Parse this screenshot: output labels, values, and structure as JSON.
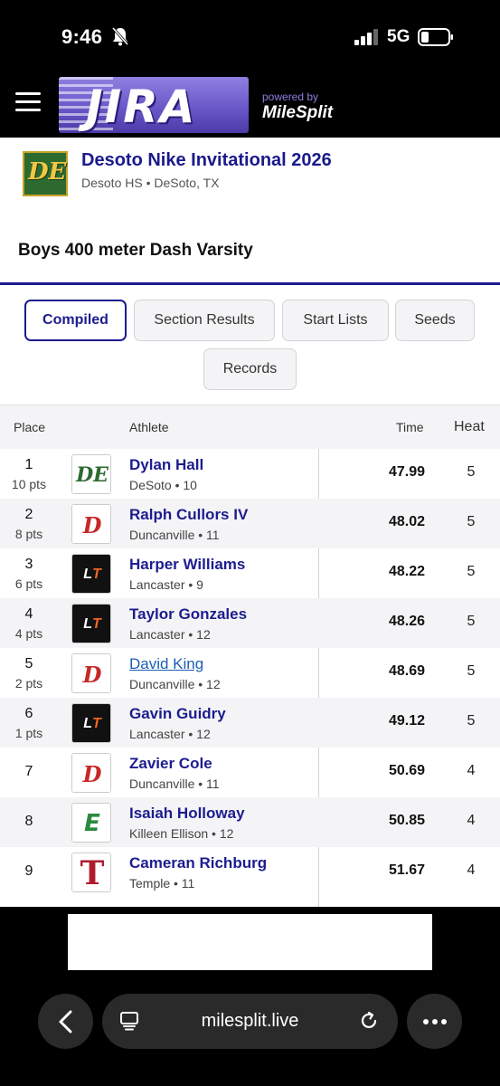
{
  "status_bar": {
    "time": "9:46",
    "network": "5G"
  },
  "header": {
    "logo_text": "JIRA",
    "powered_by": "powered by",
    "partner": "MileSplit"
  },
  "meet": {
    "logo_text": "DE",
    "title": "Desoto Nike Invitational 2026",
    "location": "Desoto HS • DeSoto, TX"
  },
  "event": {
    "title": "Boys 400 meter Dash Varsity"
  },
  "tabs": [
    {
      "label": "Compiled",
      "active": true
    },
    {
      "label": "Section Results",
      "active": false
    },
    {
      "label": "Start Lists",
      "active": false
    },
    {
      "label": "Seeds",
      "active": false
    },
    {
      "label": "Records",
      "active": false
    }
  ],
  "table": {
    "headers": {
      "place": "Place",
      "athlete": "Athlete",
      "time": "Time",
      "heat": "Heat"
    },
    "rows": [
      {
        "place": "1",
        "points": "10 pts",
        "logo": "DE",
        "athlete": "Dylan Hall",
        "team": "DeSoto • 10",
        "time": "47.99",
        "heat": "5"
      },
      {
        "place": "2",
        "points": "8 pts",
        "logo": "D",
        "athlete": "Ralph Cullors IV",
        "team": "Duncanville • 11",
        "time": "48.02",
        "heat": "5"
      },
      {
        "place": "3",
        "points": "6 pts",
        "logo": "LT",
        "athlete": "Harper Williams",
        "team": "Lancaster • 9",
        "time": "48.22",
        "heat": "5"
      },
      {
        "place": "4",
        "points": "4 pts",
        "logo": "LT",
        "athlete": "Taylor Gonzales",
        "team": "Lancaster • 12",
        "time": "48.26",
        "heat": "5"
      },
      {
        "place": "5",
        "points": "2 pts",
        "logo": "D",
        "athlete": "David King",
        "team": "Duncanville • 12",
        "time": "48.69",
        "heat": "5"
      },
      {
        "place": "6",
        "points": "1 pts",
        "logo": "LT",
        "athlete": "Gavin Guidry",
        "team": "Lancaster • 12",
        "time": "49.12",
        "heat": "5"
      },
      {
        "place": "7",
        "points": "",
        "logo": "D",
        "athlete": "Zavier Cole",
        "team": "Duncanville • 11",
        "time": "50.69",
        "heat": "4"
      },
      {
        "place": "8",
        "points": "",
        "logo": "E",
        "athlete": "Isaiah Holloway",
        "team": "Killeen Ellison • 12",
        "time": "50.85",
        "heat": "4"
      },
      {
        "place": "9",
        "points": "",
        "logo": "T",
        "athlete": "Cameran Richburg",
        "team": "Temple • 11",
        "time": "51.67",
        "heat": "4"
      }
    ]
  },
  "browser": {
    "url": "milesplit.live"
  },
  "colors": {
    "accent": "#1c1c8f",
    "link": "#1a5fb4",
    "logo_purple": "#6a58c9"
  }
}
